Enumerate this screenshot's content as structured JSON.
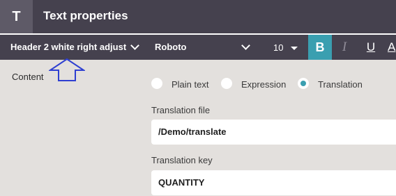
{
  "window": {
    "title": "Text properties",
    "icon_letter": "T"
  },
  "toolbar": {
    "style_value": "Header 2 white right adjust",
    "font_value": "Roboto",
    "size_value": "10",
    "bold_label": "B",
    "italic_label": "I",
    "underline_label": "U",
    "color_label": "A",
    "accent_color": "#3a9fb0"
  },
  "content": {
    "label": "Content",
    "mode_options": [
      {
        "label": "Plain text",
        "selected": false
      },
      {
        "label": "Expression",
        "selected": false
      },
      {
        "label": "Translation",
        "selected": true
      }
    ],
    "translation_file_label": "Translation file",
    "translation_file_value": "/Demo/translate",
    "translation_key_label": "Translation key",
    "translation_key_value": "QUANTITY"
  }
}
